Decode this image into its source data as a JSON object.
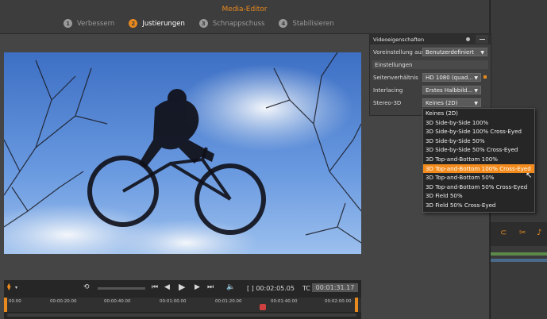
{
  "app": {
    "title": "Media-Editor"
  },
  "steps": [
    {
      "num": "1",
      "label": "Verbessern",
      "active": false
    },
    {
      "num": "2",
      "label": "Justierungen",
      "active": true
    },
    {
      "num": "3",
      "label": "Schnappschuss",
      "active": false
    },
    {
      "num": "4",
      "label": "Stabilisieren",
      "active": false
    }
  ],
  "panel": {
    "title": "Videoeigenschaften",
    "preset_label": "Voreinstellung aus:",
    "preset_value": "Benutzerdefiniert",
    "settings_header": "Einstellungen",
    "aspect_label": "Seitenverhältnis",
    "aspect_value": "HD 1080 (quad...",
    "interlacing_label": "Interlacing",
    "interlacing_value": "Erstes Halbbild...",
    "stereo_label": "Stereo-3D",
    "stereo_value": "Keines (2D)"
  },
  "stereo_options": [
    "Keines (2D)",
    "3D Side-by-Side 100%",
    "3D Side-by-Side 100% Cross-Eyed",
    "3D Side-by-Side 50%",
    "3D Side-by-Side 50% Cross-Eyed",
    "3D Top-and-Bottom 100%",
    "3D Top-and-Bottom 100% Cross-Eyed",
    "3D Top-and-Bottom 50%",
    "3D Top-and-Bottom 50% Cross-Eyed",
    "3D Field 50%",
    "3D Field 50% Cross-Eyed"
  ],
  "highlighted_option": "3D Top-and-Bottom 100% Cross-Eyed",
  "transport": {
    "timecode": "[ ] 00:02:05.05",
    "tc_label": "TC",
    "tc_value": "00:01:31.17"
  },
  "ruler_labels": [
    "00.00",
    "00:00:20.00",
    "00:00:40.00",
    "00:01:00.00",
    "00:01:20.00",
    "00:01:40.00",
    "00:02:00.00"
  ],
  "colors": {
    "accent": "#e88a1e",
    "highlight": "#f28b1c"
  }
}
